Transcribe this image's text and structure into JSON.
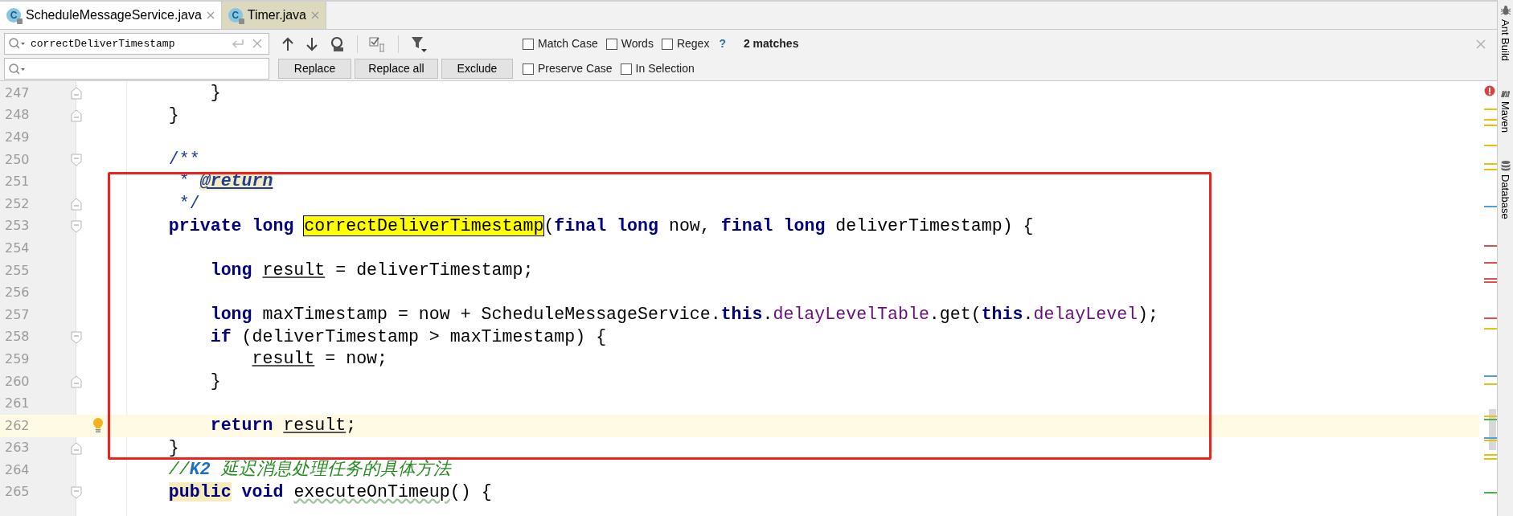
{
  "tabs": [
    {
      "badge": "C",
      "label": "ScheduleMessageService.java",
      "selected": true
    },
    {
      "badge": "C",
      "label": "Timer.java",
      "selected": false
    }
  ],
  "find": {
    "search": {
      "value": "correctDeliverTimestamp"
    },
    "search_options": [
      {
        "label": "Match Case",
        "checked": false
      },
      {
        "label": "Words",
        "checked": false
      },
      {
        "label": "Regex",
        "checked": false
      }
    ],
    "help": "?",
    "match_count": "2 matches",
    "replace_options": [
      {
        "label": "Preserve Case",
        "checked": false
      },
      {
        "label": "In Selection",
        "checked": false
      }
    ],
    "buttons": [
      "Replace",
      "Replace all",
      "Exclude"
    ]
  },
  "editor": {
    "lines": [
      {
        "number": "247",
        "fold_start": false,
        "fold_end": true,
        "current": false,
        "segments": [
          {
            "kind": "text",
            "text": "        }"
          }
        ]
      },
      {
        "number": "248",
        "fold_start": false,
        "fold_end": true,
        "current": false,
        "segments": [
          {
            "kind": "text",
            "text": "    }"
          }
        ]
      },
      {
        "number": "249",
        "fold_start": false,
        "fold_end": false,
        "current": false
      },
      {
        "number": "250",
        "fold_start": true,
        "fold_end": false,
        "current": false,
        "segments": [
          {
            "kind": "doc",
            "text": "    /**"
          }
        ]
      },
      {
        "number": "251",
        "fold_start": false,
        "fold_end": false,
        "current": false,
        "segments": [
          {
            "kind": "doc",
            "text": "     * "
          },
          {
            "kind": "doc_tag",
            "text": "@return"
          }
        ]
      },
      {
        "number": "252",
        "fold_start": false,
        "fold_end": true,
        "current": false,
        "segments": [
          {
            "kind": "doc",
            "text": "     */"
          }
        ]
      },
      {
        "number": "253",
        "fold_start": true,
        "fold_end": false,
        "current": false,
        "segments": [
          {
            "kind": "keyword",
            "text": "    private "
          },
          {
            "kind": "keyword",
            "text": "long "
          },
          {
            "kind": "match",
            "text": "correctDeliverTimestamp"
          },
          {
            "kind": "text",
            "text": "("
          },
          {
            "kind": "keyword",
            "text": "final "
          },
          {
            "kind": "keyword",
            "text": "long "
          },
          {
            "kind": "text",
            "text": "now, "
          },
          {
            "kind": "keyword",
            "text": "final "
          },
          {
            "kind": "keyword",
            "text": "long "
          },
          {
            "kind": "text",
            "text": "deliverTimestamp) {"
          }
        ]
      },
      {
        "number": "254",
        "fold_start": false,
        "fold_end": false,
        "current": false
      },
      {
        "number": "255",
        "fold_start": false,
        "fold_end": false,
        "current": false,
        "segments": [
          {
            "kind": "keyword",
            "text": "        long "
          },
          {
            "kind": "var",
            "text": "result"
          },
          {
            "kind": "text",
            "text": " = deliverTimestamp;"
          }
        ]
      },
      {
        "number": "256",
        "fold_start": false,
        "fold_end": false,
        "current": false
      },
      {
        "number": "257",
        "fold_start": false,
        "fold_end": false,
        "current": false,
        "segments": [
          {
            "kind": "keyword",
            "text": "        long"
          },
          {
            "kind": "text",
            "text": " maxTimestamp = now + ScheduleMessageService."
          },
          {
            "kind": "keyword",
            "text": "this"
          },
          {
            "kind": "text",
            "text": "."
          },
          {
            "kind": "field",
            "text": "delayLevelTable"
          },
          {
            "kind": "text",
            "text": ".get("
          },
          {
            "kind": "keyword",
            "text": "this"
          },
          {
            "kind": "text",
            "text": "."
          },
          {
            "kind": "field",
            "text": "delayLevel"
          },
          {
            "kind": "text",
            "text": ");"
          }
        ]
      },
      {
        "number": "258",
        "fold_start": true,
        "fold_end": false,
        "current": false,
        "segments": [
          {
            "kind": "keyword",
            "text": "        if"
          },
          {
            "kind": "text",
            "text": " (deliverTimestamp > maxTimestamp) {"
          }
        ]
      },
      {
        "number": "259",
        "fold_start": false,
        "fold_end": false,
        "current": false,
        "segments": [
          {
            "kind": "var",
            "text": "            result"
          },
          {
            "kind": "text",
            "text": " = now;"
          }
        ]
      },
      {
        "number": "260",
        "fold_start": false,
        "fold_end": true,
        "current": false,
        "segments": [
          {
            "kind": "text",
            "text": "        }"
          }
        ]
      },
      {
        "number": "261",
        "fold_start": false,
        "fold_end": false,
        "current": false
      },
      {
        "number": "262",
        "fold_start": false,
        "fold_end": false,
        "current": true,
        "segments": [
          {
            "kind": "keyword",
            "text": "        return "
          },
          {
            "kind": "var",
            "text": "result"
          },
          {
            "kind": "text",
            "text": ";"
          }
        ]
      },
      {
        "number": "263",
        "fold_start": false,
        "fold_end": true,
        "current": false,
        "segments": [
          {
            "kind": "text",
            "text": "    }"
          }
        ]
      },
      {
        "number": "264",
        "fold_start": false,
        "fold_end": false,
        "current": false,
        "segments": [
          {
            "kind": "comment",
            "text": "    //"
          },
          {
            "kind": "comment_tag",
            "text": "K2"
          },
          {
            "kind": "comment",
            "text": " 延迟消息处理任务的具体方法"
          }
        ]
      },
      {
        "number": "265",
        "fold_start": true,
        "fold_end": false,
        "current": false,
        "segments": [
          {
            "kind": "keyword_marked",
            "text": "    public"
          },
          {
            "kind": "keyword",
            "text": " void "
          },
          {
            "kind": "typo",
            "text": "executeOnTimeup"
          },
          {
            "kind": "text",
            "text": "() {"
          }
        ]
      }
    ]
  },
  "tool_windows": [
    {
      "kind": "ant",
      "label": "Ant Build"
    },
    {
      "kind": "maven",
      "label": "Maven"
    },
    {
      "kind": "database",
      "label": "Database"
    }
  ]
}
